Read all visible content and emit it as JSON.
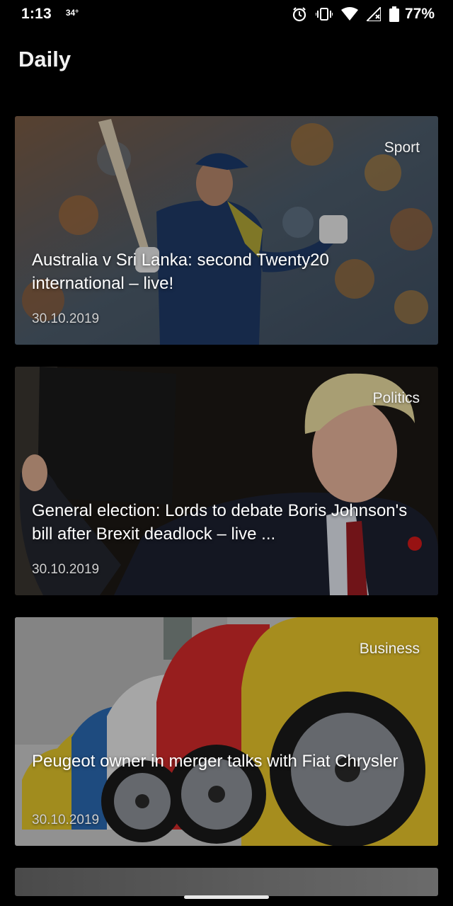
{
  "status_bar": {
    "time": "1:13",
    "temperature": "34°",
    "battery": "77%",
    "icons": [
      "alarm-icon",
      "vibrate-icon",
      "wifi-icon",
      "signal-icon",
      "battery-icon"
    ]
  },
  "app": {
    "title": "Daily"
  },
  "articles": [
    {
      "category": "Sport",
      "title": "Australia v Sri Lanka: second Twenty20 international – live!",
      "date": "30.10.2019"
    },
    {
      "category": "Politics",
      "title": "General election: Lords to debate Boris Johnson's bill after Brexit deadlock – live ...",
      "date": "30.10.2019"
    },
    {
      "category": "Business",
      "title": "Peugeot owner in merger talks with Fiat Chrysler",
      "date": "30.10.2019"
    }
  ],
  "colors": {
    "background": "#000000",
    "text": "#ffffff",
    "date_text": "#cfcfcf"
  }
}
